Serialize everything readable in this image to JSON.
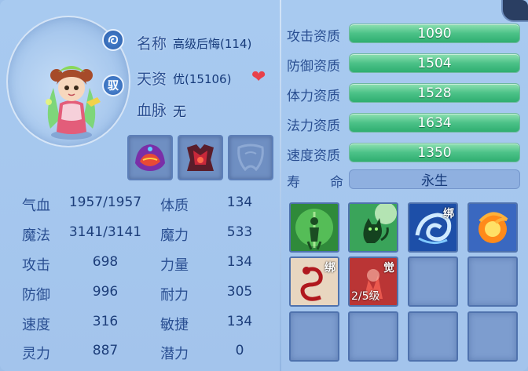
{
  "pet": {
    "name_label": "名称",
    "name_value": "高级后悔(114)",
    "talent_label": "天资",
    "talent_value": "优(15106)",
    "blood_label": "血脉",
    "blood_value": "无",
    "ride_glyph": "驭"
  },
  "stats": [
    {
      "label": "气血",
      "value": "1957/1957",
      "label2": "体质",
      "value2": "134"
    },
    {
      "label": "魔法",
      "value": "3141/3141",
      "label2": "魔力",
      "value2": "533"
    },
    {
      "label": "攻击",
      "value": "698",
      "label2": "力量",
      "value2": "134"
    },
    {
      "label": "防御",
      "value": "996",
      "label2": "耐力",
      "value2": "305"
    },
    {
      "label": "速度",
      "value": "316",
      "label2": "敏捷",
      "value2": "134"
    },
    {
      "label": "灵力",
      "value": "887",
      "label2": "潜力",
      "value2": "0"
    }
  ],
  "aptitudes": [
    {
      "label": "攻击资质",
      "value": "1090"
    },
    {
      "label": "防御资质",
      "value": "1504"
    },
    {
      "label": "体力资质",
      "value": "1528"
    },
    {
      "label": "法力资质",
      "value": "1634"
    },
    {
      "label": "速度资质",
      "value": "1350"
    }
  ],
  "life": {
    "label_a": "寿",
    "label_b": "命",
    "value": "永生"
  },
  "skills": [
    {
      "icon": "green-figure-skill-icon"
    },
    {
      "icon": "green-cat-skill-icon"
    },
    {
      "icon": "water-swirl-skill-icon",
      "badge": "绑"
    },
    {
      "icon": "fire-swirl-skill-icon"
    },
    {
      "icon": "red-serpent-skill-icon",
      "badge": "绑"
    },
    {
      "icon": "awaken-skill-icon",
      "badge": "觉",
      "level": "2/5级"
    }
  ],
  "colors": {
    "bar_green": "#3fb87c",
    "label_blue": "#2a4f92",
    "heart": "#e8404a"
  }
}
